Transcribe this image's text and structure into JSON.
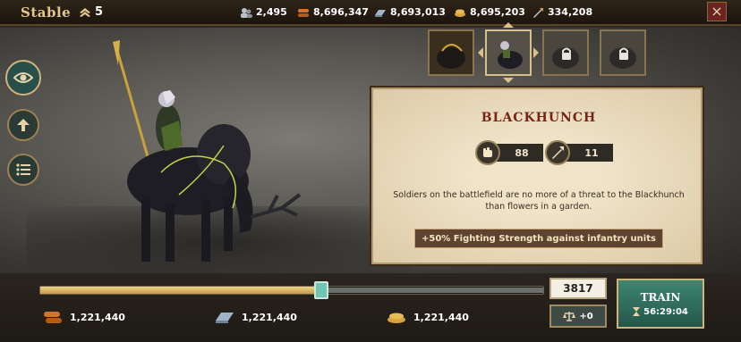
{
  "header": {
    "title": "Stable",
    "rank": "5",
    "resources": [
      {
        "icon": "population-icon",
        "value": "2,495"
      },
      {
        "icon": "wood-icon",
        "value": "8,696,347"
      },
      {
        "icon": "iron-icon",
        "value": "8,693,013"
      },
      {
        "icon": "wheat-icon",
        "value": "8,695,203"
      },
      {
        "icon": "power-icon",
        "value": "334,208"
      }
    ],
    "close": "×"
  },
  "sidebar": {
    "buttons": [
      {
        "icon": "eye-icon",
        "active": true
      },
      {
        "icon": "upgrade-arrow-icon",
        "active": false
      },
      {
        "icon": "list-icon",
        "active": false
      }
    ]
  },
  "units": [
    {
      "name": "unit-portrait-1",
      "locked": false
    },
    {
      "name": "unit-portrait-blackhunch",
      "locked": false,
      "selected": true
    },
    {
      "name": "unit-portrait-3",
      "locked": true
    },
    {
      "name": "unit-portrait-4",
      "locked": true
    }
  ],
  "info": {
    "unit_name": "BLACKHUNCH",
    "attack": "88",
    "defense": "11",
    "description": "Soldiers on the battlefield are no more of a threat to the Blackhunch than flowers in a garden.",
    "bonus": "+50% Fighting Strength against infantry units"
  },
  "training": {
    "slider_fraction": 0.56,
    "quantity": "3817",
    "balance_label": "+0",
    "train_label": "TRAIN",
    "time": "56:29:04",
    "costs": [
      {
        "icon": "wood-icon",
        "value": "1,221,440"
      },
      {
        "icon": "iron-icon",
        "value": "1,221,440"
      },
      {
        "icon": "wheat-icon",
        "value": "1,221,440"
      }
    ]
  },
  "colors": {
    "accent_gold": "#e3c88e",
    "train_green": "#3e8672",
    "title_red": "#7a2418"
  }
}
